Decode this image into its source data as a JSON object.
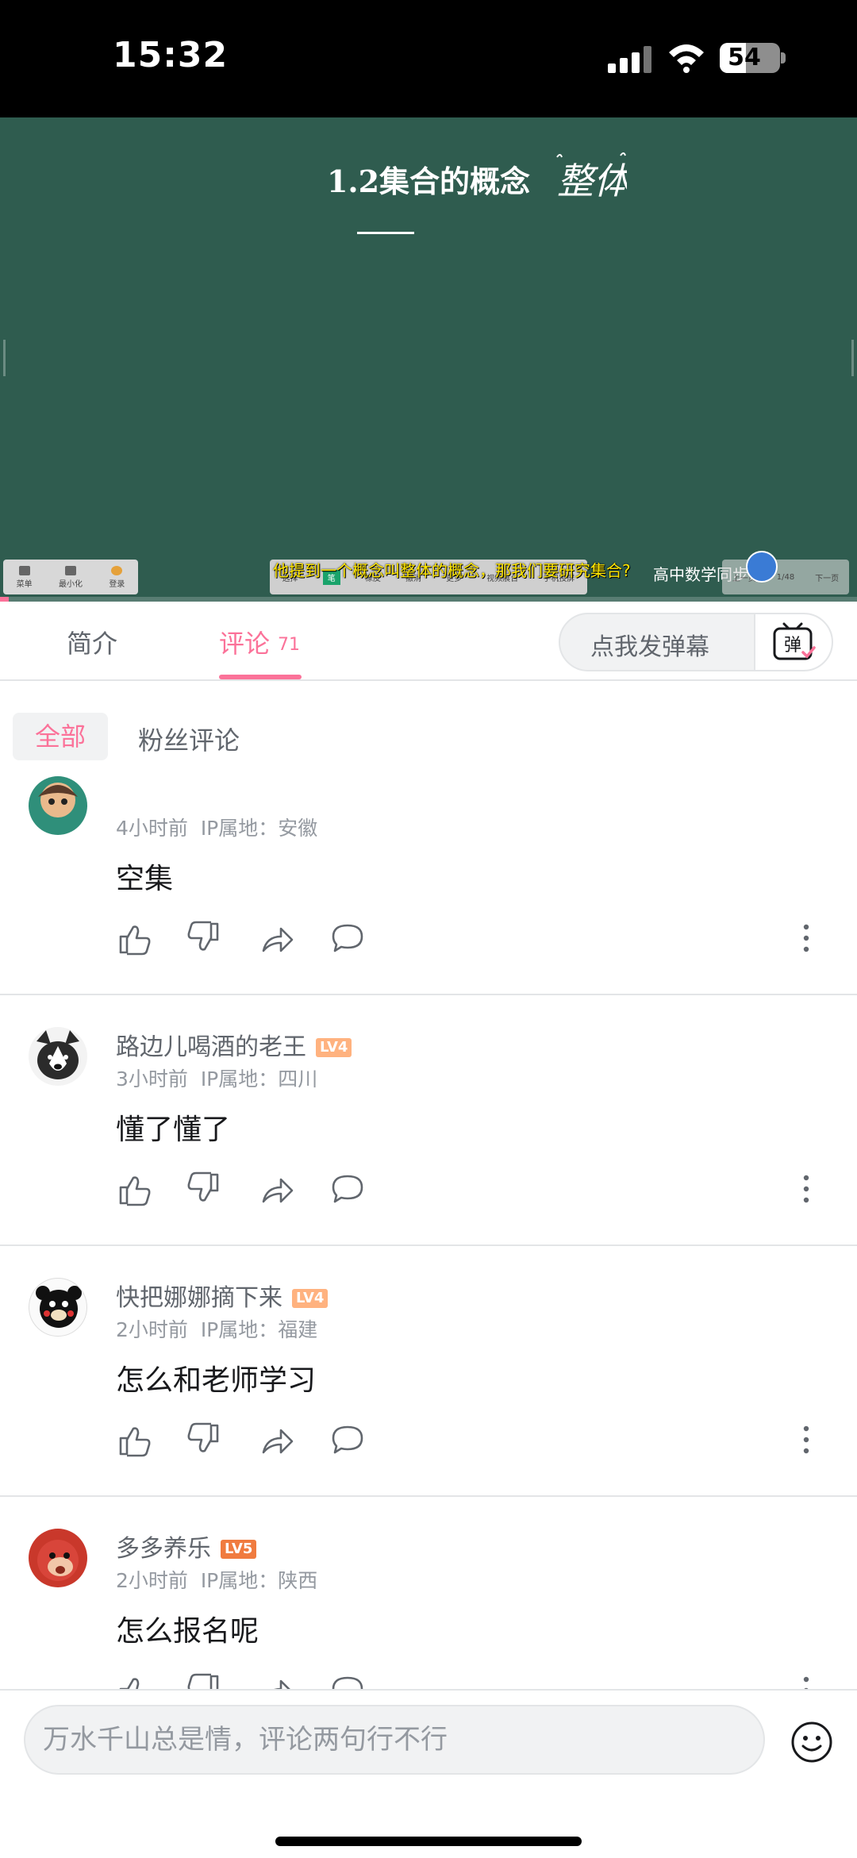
{
  "status_bar": {
    "time": "15:32",
    "battery": "54",
    "battery_level": 0.54
  },
  "video": {
    "board_title": "1.2集合的概念",
    "handwriting": "整体",
    "subtitle": "他提到一个概念叫整体的概念，那我们要研究集合?",
    "course_label": "高中数学同步课",
    "progress": 0.01,
    "toolbar_left": [
      "菜单",
      "最小化",
      "登录"
    ],
    "toolbar_mid": [
      "选择",
      "笔",
      "橡皮",
      "撤消",
      "更多",
      "视频展台",
      "手机投屏"
    ],
    "toolbar_right": [
      "上一页",
      "1/48",
      "下一页"
    ]
  },
  "tabs": {
    "intro": "简介",
    "comments": "评论",
    "comment_count": "71"
  },
  "danmaku": {
    "placeholder": "点我发弹幕",
    "button": "弹"
  },
  "filters": {
    "all": "全部",
    "fans": "粉丝评论"
  },
  "comments": [
    {
      "username": "",
      "level": "",
      "time": "4小时前",
      "ip": "IP属地：安徽",
      "content": "空集"
    },
    {
      "username": "路边儿喝酒的老王",
      "level": "LV4",
      "time": "3小时前",
      "ip": "IP属地：四川",
      "content": "懂了懂了"
    },
    {
      "username": "快把娜娜摘下来",
      "level": "LV4",
      "time": "2小时前",
      "ip": "IP属地：福建",
      "content": "怎么和老师学习"
    },
    {
      "username": "多多养乐",
      "level": "LV5",
      "time": "2小时前",
      "ip": "IP属地：陕西",
      "content": "怎么报名呢"
    }
  ],
  "input": {
    "placeholder": "万水千山总是情，评论两句行不行"
  },
  "colors": {
    "accent": "#fb7299",
    "board": "#2f5c4f",
    "lv4": "#ffb27f",
    "lv5": "#f07b3f"
  }
}
